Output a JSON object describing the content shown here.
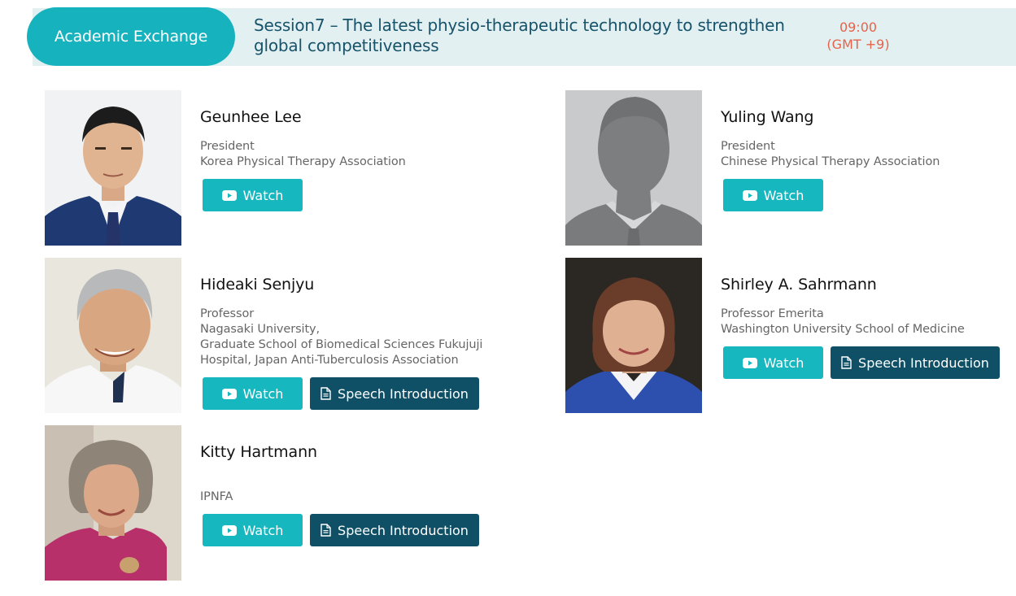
{
  "header": {
    "category": "Academic Exchange",
    "session_title": "Session7 – The latest physio-therapeutic technology to strengthen global competitiveness",
    "time": "09:00",
    "timezone": "(GMT +9)"
  },
  "buttons": {
    "watch_label": "Watch",
    "speech_label": "Speech Introduction"
  },
  "speakers": [
    {
      "name": "Geunhee Lee",
      "role_lines": [
        "President",
        "Korea Physical Therapy Association"
      ],
      "buttons": [
        "Watch"
      ]
    },
    {
      "name": "Yuling Wang",
      "role_lines": [
        "President",
        "Chinese Physical Therapy Association"
      ],
      "buttons": [
        "Watch"
      ]
    },
    {
      "name": "Hideaki Senjyu",
      "role_lines": [
        "Professor",
        "Nagasaki University,",
        "Graduate School of Biomedical Sciences Fukujuji",
        "Hospital, Japan Anti-Tuberculosis Association"
      ],
      "buttons": [
        "Watch",
        "Speech Introduction"
      ]
    },
    {
      "name": "Shirley A. Sahrmann",
      "role_lines": [
        "Professor Emerita",
        "Washington University School of Medicine"
      ],
      "buttons": [
        "Watch",
        "Speech Introduction"
      ]
    },
    {
      "name": "Kitty Hartmann",
      "role_lines": [
        "",
        "IPNFA"
      ],
      "buttons": [
        "Watch",
        "Speech Introduction"
      ]
    }
  ],
  "colors": {
    "accent_teal": "#16b7bf",
    "dark_teal": "#0f5066",
    "title_color": "#17536a",
    "time_color": "#e5634a",
    "band_bg": "#e3f0f1"
  },
  "icons": {
    "watch": "youtube-play-icon",
    "speech": "document-icon"
  }
}
